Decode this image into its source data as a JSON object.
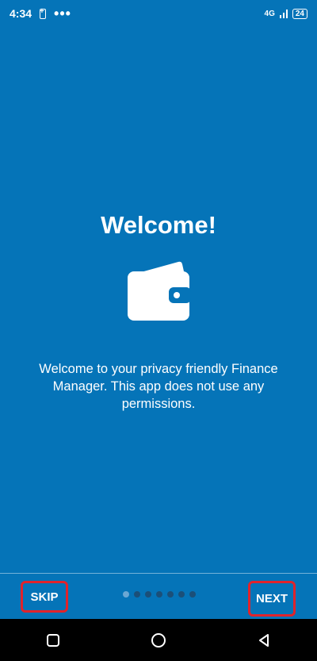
{
  "status_bar": {
    "time": "4:34",
    "dots": "•••",
    "network_label": "4G",
    "battery_level": "24",
    "icons": [
      "battery-saver-icon",
      "signal-icon",
      "battery-icon"
    ]
  },
  "onboarding": {
    "title": "Welcome!",
    "icon": "wallet-icon",
    "description": "Welcome to your privacy friendly Finance Manager. This app does not use any permissions."
  },
  "footer": {
    "skip_label": "SKIP",
    "next_label": "NEXT",
    "page_indicator": {
      "current": 1,
      "total": 7
    }
  },
  "navigation_bar": {
    "icons": [
      "recent-apps-icon",
      "home-icon",
      "back-icon"
    ]
  },
  "colors": {
    "background": "#0574b8",
    "highlight_border": "#e1232b",
    "dot_active": "#6ba7d3",
    "dot_inactive": "#1b4f78"
  }
}
